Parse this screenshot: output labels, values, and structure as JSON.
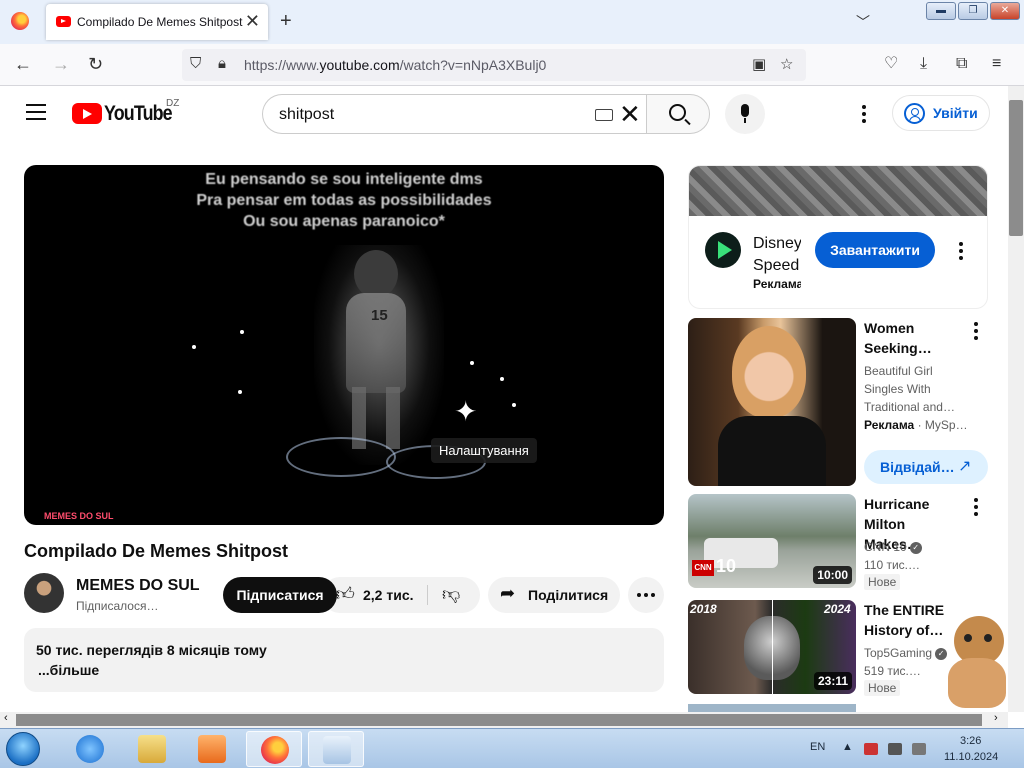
{
  "browser": {
    "tab_title": "Compilado De Memes Shitpost",
    "tab_close": "✕",
    "new_tab": "+",
    "url_scheme": "https://www.",
    "url_host": "youtube.com",
    "url_path": "/watch?v=nNpA3XBulj0"
  },
  "youtube": {
    "wordmark": "YouTube",
    "country": "DZ",
    "search_value": "shitpost",
    "sign_in": "Увійти"
  },
  "player": {
    "caption": [
      "Eu pensando se sou inteligente dms",
      "Pra pensar em todas as possibilidades",
      "Ou sou apenas paranoico*"
    ],
    "jersey_number": "15",
    "tooltip": "Налаштування",
    "watermark": "MEMES DO SUL"
  },
  "video": {
    "title": "Compilado De Memes Shitpost",
    "channel_name": "MEMES DO SUL",
    "channel_subs": "Підписалося…",
    "subscribe": "Підписатися",
    "likes": "2,2 тис.",
    "share": "Поділитися",
    "views_date": "50 тис. переглядів  8 місяців тому",
    "more": "...більше"
  },
  "sidebar": {
    "ad": {
      "title_line1": "Disney",
      "title_line2": "Speed",
      "label": "Реклама",
      "cta": "Завантажити"
    },
    "items": [
      {
        "title_line1": "Women",
        "title_line2": "Seeking…",
        "desc_line1": "Beautiful Girl",
        "desc_line2": "Singles With",
        "desc_line3": "Traditional and…",
        "ad_label": "Реклама",
        "ad_source": " · MySp…",
        "cta": "Відвідай…"
      },
      {
        "title_line1": "Hurricane",
        "title_line2": "Milton Makes…",
        "channel": "CNN 10",
        "views": "110 тис.…",
        "badge": "Нове",
        "duration": "10:00",
        "thumb_logo": "CNN",
        "thumb_num": "10"
      },
      {
        "title_line1": "The ENTIRE",
        "title_line2": "History of…",
        "channel": "Top5Gaming",
        "views": "519 тис.…",
        "badge": "Нове",
        "duration": "23:11",
        "year_left": "2018",
        "year_right": "2024"
      }
    ]
  },
  "taskbar": {
    "lang": "EN",
    "time": "3:26",
    "date": "11.10.2024"
  },
  "colors": {
    "yt_red": "#ff0000",
    "yt_blue": "#065fd4",
    "chrome_bg": "#e8f0fb",
    "taskbar": "#b7d0ec"
  }
}
